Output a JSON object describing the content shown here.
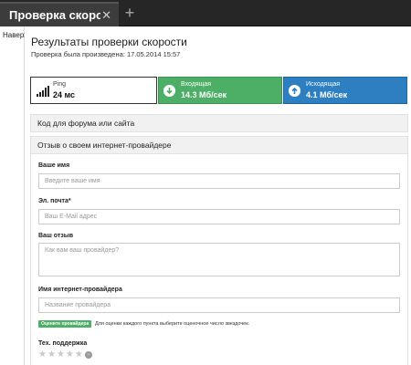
{
  "browser": {
    "tab_title": "Проверка скорост…",
    "tab_close": "✕",
    "new_tab": "+"
  },
  "nav": {
    "to_top": "Наверх"
  },
  "page": {
    "title": "Результаты проверки скорости",
    "check_date": "Проверка была произведена: 17.05.2014 15:57"
  },
  "metrics": {
    "ping": {
      "label": "Ping",
      "value": "24 мс",
      "icon": "signal-bars-icon"
    },
    "download": {
      "label": "Входящая",
      "value": "14.3 Мб/сек",
      "icon": "arrow-down-circle-icon",
      "color": "#4caf65"
    },
    "upload": {
      "label": "Исходящая",
      "value": "4.1 Мб/сек",
      "icon": "arrow-up-circle-icon",
      "color": "#2d7fc1"
    }
  },
  "sections": {
    "forum_code": "Код для форума или сайта",
    "review": "Отзыв о своем интернет-провайдере"
  },
  "form": {
    "name_label": "Ваше имя",
    "name_placeholder": "Введите ваше имя",
    "email_label": "Эл. почта",
    "email_required_mark": "*",
    "email_placeholder": "Ваш E-Mail адрес",
    "review_label": "Ваш отзыв",
    "review_placeholder": "Как вам ваш провайдер?",
    "provider_label": "Имя интернет-провайдера",
    "provider_placeholder": "Название провайдера",
    "rate_badge": "Оцените провайдера",
    "rate_hint": "Для оценки каждого пункта выберите оценочное число звездочек.",
    "support_label": "Тех. поддержка",
    "support_rating": 0,
    "support_max": 5
  }
}
